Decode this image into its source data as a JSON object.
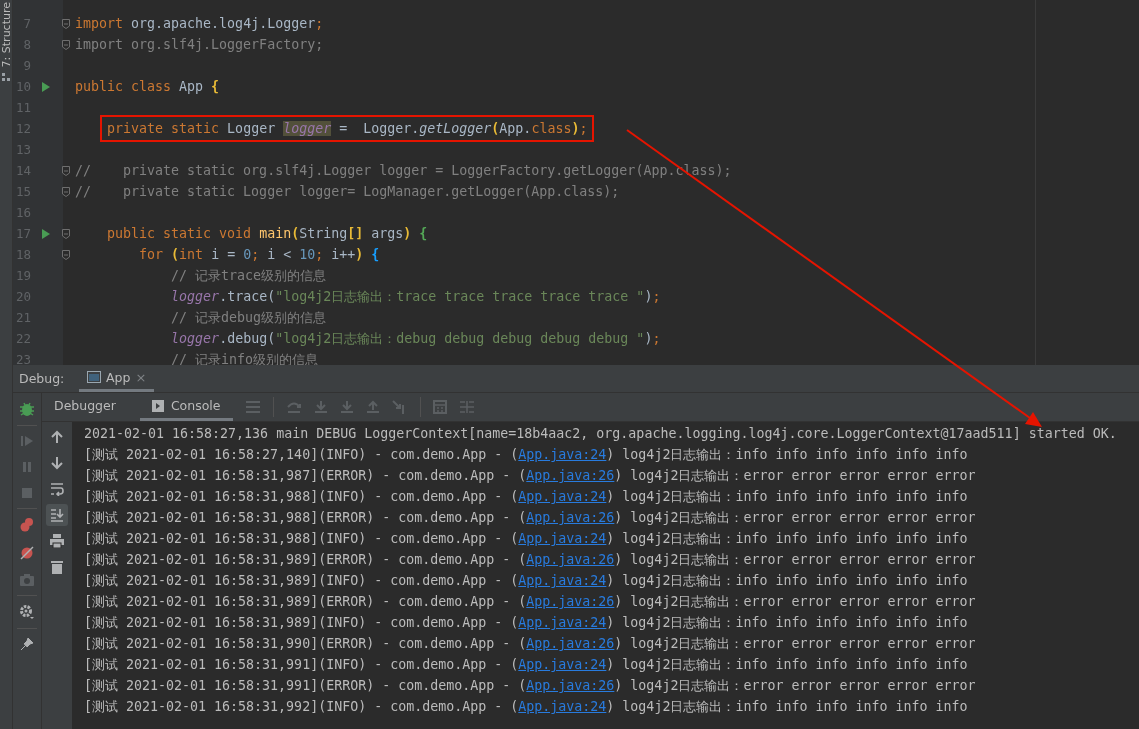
{
  "side_tool_window": {
    "label": "7: Structure"
  },
  "editor": {
    "lines": [
      {
        "number": "7",
        "fold": true,
        "segments": [
          {
            "text": "import",
            "kind": "keyword"
          },
          {
            "text": " org.apache.log4j.Logger",
            "kind": "plain"
          },
          {
            "text": ";",
            "kind": "keyword"
          }
        ]
      },
      {
        "number": "8",
        "fold": true,
        "segments": [
          {
            "text": "import org.slf4j.LoggerFactory;",
            "kind": "unused"
          }
        ]
      },
      {
        "number": "9"
      },
      {
        "number": "10",
        "run": true,
        "segments": [
          {
            "text": "public class",
            "kind": "keyword"
          },
          {
            "text": " App ",
            "kind": "plain"
          },
          {
            "text": "{",
            "kind": "bracket",
            "color": "#e8ba36"
          }
        ]
      },
      {
        "number": "11"
      },
      {
        "number": "12",
        "boxed": true,
        "segments": [
          {
            "text": "    private static",
            "kind": "keyword"
          },
          {
            "text": " Logger ",
            "kind": "plain"
          },
          {
            "text": "logger",
            "kind": "field_caret"
          },
          {
            "text": " =  Logger.",
            "kind": "plain"
          },
          {
            "text": "getLogger",
            "kind": "static_call"
          },
          {
            "text": "(",
            "kind": "bracket",
            "color": "#e8ba36"
          },
          {
            "text": "App.",
            "kind": "plain"
          },
          {
            "text": "class",
            "kind": "keyword"
          },
          {
            "text": ")",
            "kind": "bracket",
            "color": "#e8ba36"
          },
          {
            "text": ";",
            "kind": "keyword"
          }
        ]
      },
      {
        "number": "13"
      },
      {
        "number": "14",
        "fold": true,
        "segments": [
          {
            "text": "//    private static org.slf4j.Logger logger = LoggerFactory.getLogger(App.class);",
            "kind": "comment"
          }
        ]
      },
      {
        "number": "15",
        "fold": true,
        "segments": [
          {
            "text": "//    private static Logger logger= LogManager.getLogger(App.class);",
            "kind": "comment"
          }
        ]
      },
      {
        "number": "16"
      },
      {
        "number": "17",
        "run": true,
        "fold": true,
        "segments": [
          {
            "text": "    public static void ",
            "kind": "keyword"
          },
          {
            "text": "main",
            "kind": "declaration"
          },
          {
            "text": "(",
            "kind": "bracket",
            "color": "#e8ba36"
          },
          {
            "text": "String",
            "kind": "plain"
          },
          {
            "text": "[]",
            "kind": "bracket",
            "color": "#e8ba36"
          },
          {
            "text": " args",
            "kind": "plain"
          },
          {
            "text": ")",
            "kind": "bracket",
            "color": "#e8ba36"
          },
          {
            "text": " {",
            "kind": "bracket",
            "color": "#54a857"
          }
        ]
      },
      {
        "number": "18",
        "fold": true,
        "segments": [
          {
            "text": "        for ",
            "kind": "keyword"
          },
          {
            "text": "(",
            "kind": "bracket",
            "color": "#e8ba36"
          },
          {
            "text": "int",
            "kind": "keyword"
          },
          {
            "text": " i = ",
            "kind": "plain"
          },
          {
            "text": "0",
            "kind": "number"
          },
          {
            "text": ";",
            "kind": "keyword"
          },
          {
            "text": " i < ",
            "kind": "plain"
          },
          {
            "text": "10",
            "kind": "number"
          },
          {
            "text": ";",
            "kind": "keyword"
          },
          {
            "text": " i++",
            "kind": "plain"
          },
          {
            "text": ")",
            "kind": "bracket",
            "color": "#e8ba36"
          },
          {
            "text": " {",
            "kind": "bracket",
            "color": "#179fff"
          }
        ]
      },
      {
        "number": "19",
        "segments": [
          {
            "text": "            // 记录trace级别的信息",
            "kind": "comment"
          }
        ]
      },
      {
        "number": "20",
        "segments": [
          {
            "text": "            logger",
            "kind": "field"
          },
          {
            "text": ".trace(",
            "kind": "plain"
          },
          {
            "text": "\"log4j2日志输出：trace trace trace trace trace \"",
            "kind": "string"
          },
          {
            "text": ")",
            "kind": "plain"
          },
          {
            "text": ";",
            "kind": "keyword"
          }
        ]
      },
      {
        "number": "21",
        "segments": [
          {
            "text": "            // 记录debug级别的信息",
            "kind": "comment"
          }
        ]
      },
      {
        "number": "22",
        "segments": [
          {
            "text": "            logger",
            "kind": "field"
          },
          {
            "text": ".debug(",
            "kind": "plain"
          },
          {
            "text": "\"log4j2日志输出：debug debug debug debug debug \"",
            "kind": "string"
          },
          {
            "text": ")",
            "kind": "plain"
          },
          {
            "text": ";",
            "kind": "keyword"
          }
        ]
      },
      {
        "number": "23",
        "segments": [
          {
            "text": "            // 记录info级别的信息",
            "kind": "comment"
          }
        ]
      }
    ]
  },
  "debug_panel": {
    "title": "Debug:",
    "session_tab": {
      "label": "App",
      "selected": true,
      "close": "×"
    },
    "tabs": [
      {
        "label": "Debugger",
        "selected": false
      },
      {
        "label": "Console",
        "selected": true
      }
    ],
    "scroll_to_end": {
      "on": true
    },
    "console_lines": [
      {
        "text": "2021-02-01 16:58:27,136 main DEBUG LoggerContext[name=18b4aac2, org.apache.logging.log4j.core.LoggerContext@17aad511] started OK."
      },
      {
        "text": "[测试 2021-02-01 16:58:27,140](INFO) - com.demo.App - (",
        "link": "App.java:24",
        "suffix": ") log4j2日志输出：info info info info info info"
      },
      {
        "text": "[测试 2021-02-01 16:58:31,987](ERROR) - com.demo.App - (",
        "link": "App.java:26",
        "suffix": ") log4j2日志输出：error error error error error"
      },
      {
        "text": "[测试 2021-02-01 16:58:31,988](INFO) - com.demo.App - (",
        "link": "App.java:24",
        "suffix": ") log4j2日志输出：info info info info info info"
      },
      {
        "text": "[测试 2021-02-01 16:58:31,988](ERROR) - com.demo.App - (",
        "link": "App.java:26",
        "suffix": ") log4j2日志输出：error error error error error"
      },
      {
        "text": "[测试 2021-02-01 16:58:31,988](INFO) - com.demo.App - (",
        "link": "App.java:24",
        "suffix": ") log4j2日志输出：info info info info info info"
      },
      {
        "text": "[测试 2021-02-01 16:58:31,989](ERROR) - com.demo.App - (",
        "link": "App.java:26",
        "suffix": ") log4j2日志输出：error error error error error"
      },
      {
        "text": "[测试 2021-02-01 16:58:31,989](INFO) - com.demo.App - (",
        "link": "App.java:24",
        "suffix": ") log4j2日志输出：info info info info info info"
      },
      {
        "text": "[测试 2021-02-01 16:58:31,989](ERROR) - com.demo.App - (",
        "link": "App.java:26",
        "suffix": ") log4j2日志输出：error error error error error"
      },
      {
        "text": "[测试 2021-02-01 16:58:31,989](INFO) - com.demo.App - (",
        "link": "App.java:24",
        "suffix": ") log4j2日志输出：info info info info info info"
      },
      {
        "text": "[测试 2021-02-01 16:58:31,990](ERROR) - com.demo.App - (",
        "link": "App.java:26",
        "suffix": ") log4j2日志输出：error error error error error"
      },
      {
        "text": "[测试 2021-02-01 16:58:31,991](INFO) - com.demo.App - (",
        "link": "App.java:24",
        "suffix": ") log4j2日志输出：info info info info info info"
      },
      {
        "text": "[测试 2021-02-01 16:58:31,991](ERROR) - com.demo.App - (",
        "link": "App.java:26",
        "suffix": ") log4j2日志输出：error error error error error"
      },
      {
        "text": "[测试 2021-02-01 16:58:31,992](INFO) - com.demo.App - (",
        "link": "App.java:24",
        "suffix": ") log4j2日志输出：info info info info info info"
      }
    ]
  }
}
